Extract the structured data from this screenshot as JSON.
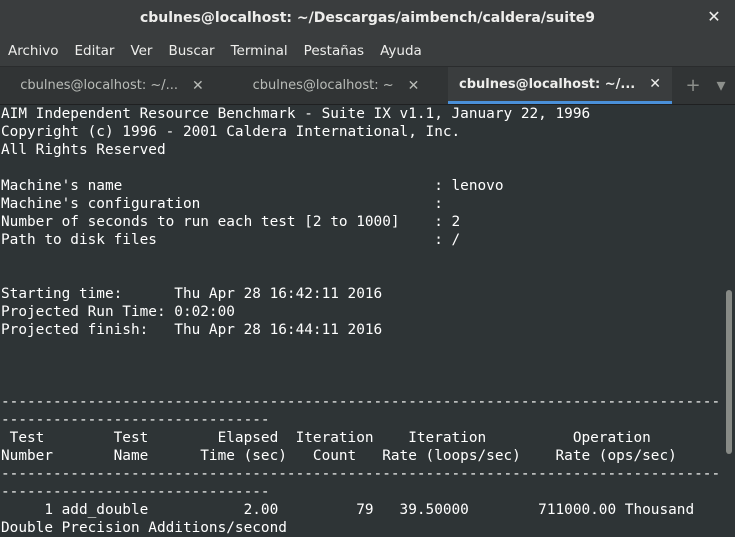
{
  "window": {
    "title": "cbulnes@localhost: ~/Descargas/aimbench/caldera/suite9",
    "close_glyph": "✕"
  },
  "menu": [
    "Archivo",
    "Editar",
    "Ver",
    "Buscar",
    "Terminal",
    "Pestañas",
    "Ayuda"
  ],
  "tabs": [
    {
      "label": "cbulnes@localhost: ~/...",
      "active": false
    },
    {
      "label": "cbulnes@localhost: ~",
      "active": false
    },
    {
      "label": "cbulnes@localhost: ~/...",
      "active": true
    }
  ],
  "tab_close_glyph": "✕",
  "tab_controls": {
    "new_tab": "+",
    "menu": "▾"
  },
  "terminal": {
    "lines": [
      "AIM Independent Resource Benchmark - Suite IX v1.1, January 22, 1996",
      "Copyright (c) 1996 - 2001 Caldera International, Inc.",
      "All Rights Reserved",
      "",
      "Machine's name                                    : lenovo",
      "Machine's configuration                           :",
      "Number of seconds to run each test [2 to 1000]    : 2",
      "Path to disk files                                : /",
      "",
      "",
      "Starting time:      Thu Apr 28 16:42:11 2016",
      "Projected Run Time: 0:02:00",
      "Projected finish:   Thu Apr 28 16:44:11 2016",
      "",
      "",
      "",
      "------------------------------------------------------------------------------------------",
      "-------------------------------",
      " Test        Test        Elapsed  Iteration    Iteration          Operation",
      "Number       Name      Time (sec)   Count   Rate (loops/sec)    Rate (ops/sec)",
      "------------------------------------------------------------------------------------------",
      "-------------------------------",
      "     1 add_double           2.00         79   39.50000        711000.00 Thousand",
      "Double Precision Additions/second"
    ]
  }
}
